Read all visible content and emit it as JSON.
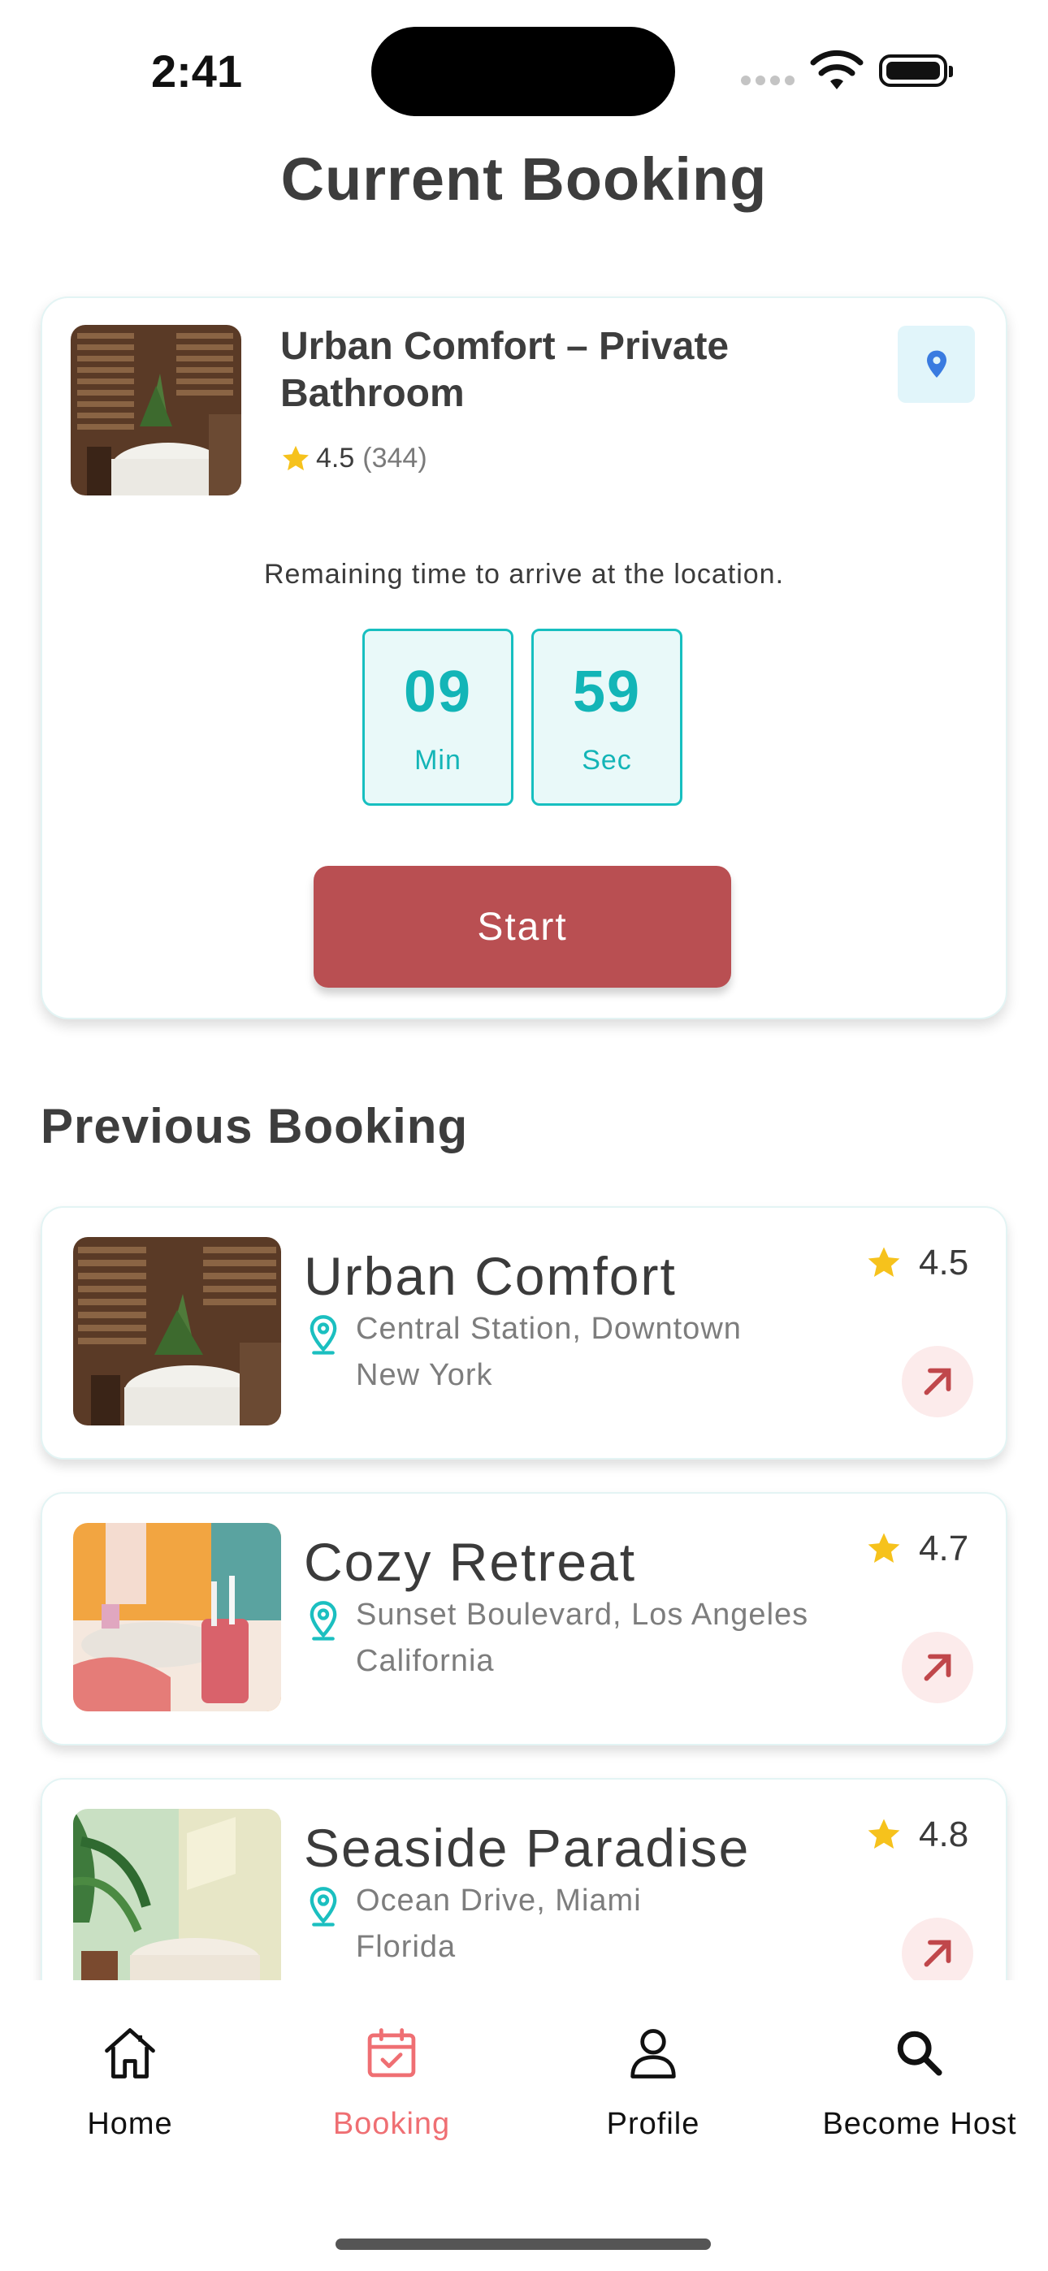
{
  "status_bar": {
    "time": "2:41"
  },
  "page_title": "Current Booking",
  "current_booking": {
    "title": "Urban Comfort – Private Bathroom",
    "rating": "4.5",
    "reviews": "(344)",
    "remaining_text": "Remaining time to arrive at the location.",
    "timer": {
      "minutes": "09",
      "minutes_label": "Min",
      "seconds": "59",
      "seconds_label": "Sec"
    },
    "start_label": "Start"
  },
  "previous_heading": "Previous Booking",
  "previous_bookings": [
    {
      "name": "Urban Comfort",
      "address_line1": "Central Station, Downtown",
      "address_line2": "New York",
      "rating": "4.5"
    },
    {
      "name": "Cozy Retreat",
      "address_line1": "Sunset Boulevard, Los Angeles",
      "address_line2": "California",
      "rating": "4.7"
    },
    {
      "name": "Seaside Paradise",
      "address_line1": "Ocean Drive, Miami",
      "address_line2": "Florida",
      "rating": "4.8"
    }
  ],
  "tabs": [
    {
      "label": "Home",
      "icon": "home-icon",
      "active": false
    },
    {
      "label": "Booking",
      "icon": "calendar-check-icon",
      "active": true
    },
    {
      "label": "Profile",
      "icon": "user-icon",
      "active": false
    },
    {
      "label": "Become Host",
      "icon": "search-icon",
      "active": false
    }
  ],
  "colors": {
    "accent_teal": "#13b5b7",
    "start_button": "#b94f52",
    "active_tab": "#ef6f73",
    "star": "#f6c21c"
  }
}
